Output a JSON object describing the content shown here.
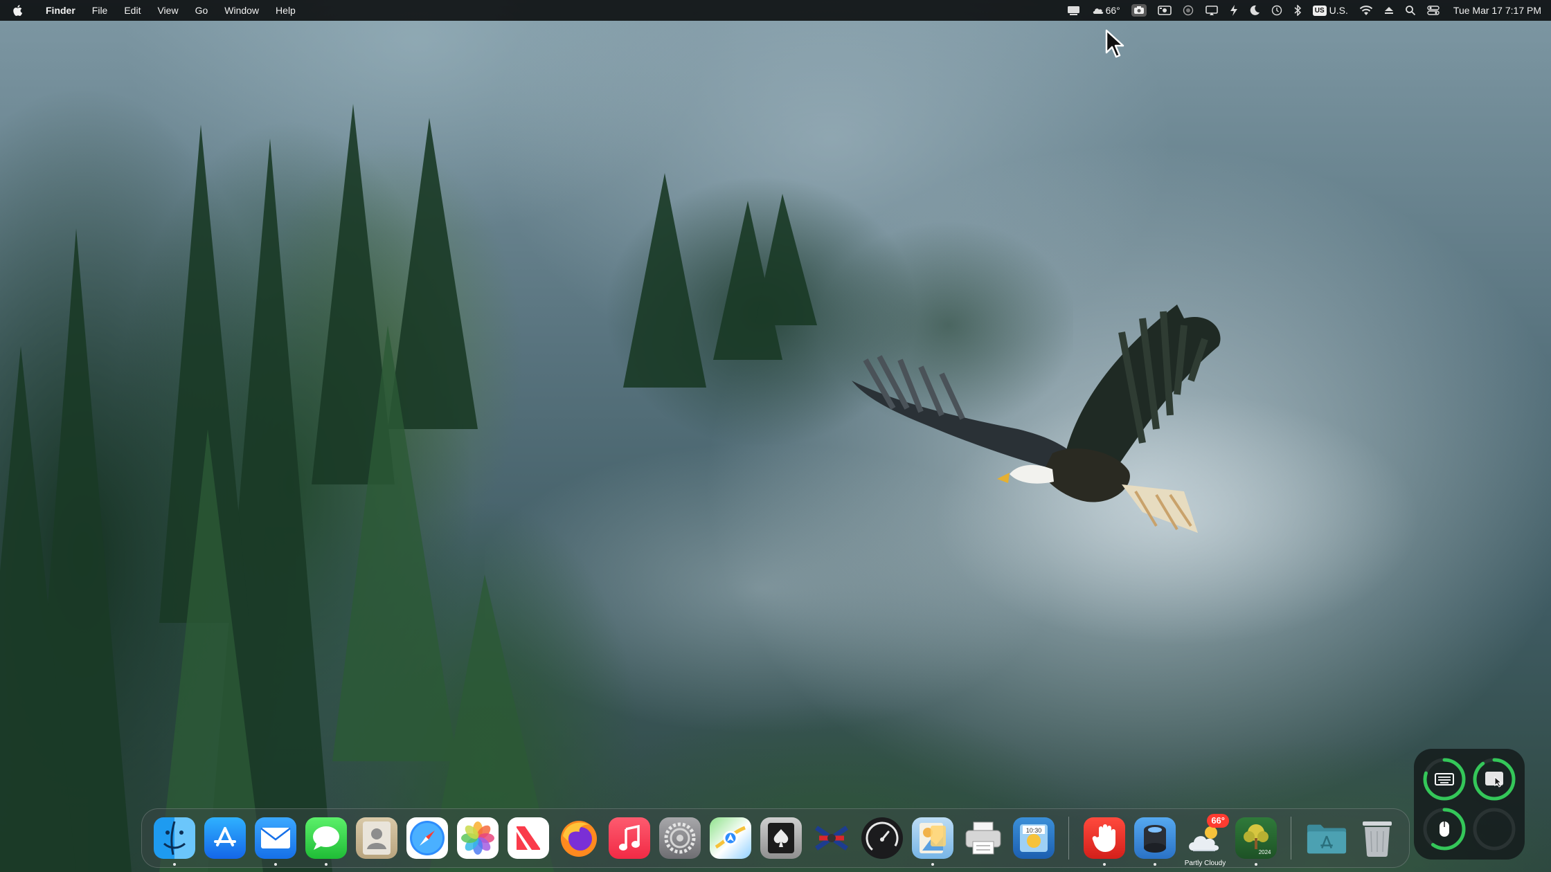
{
  "menubar": {
    "apple_icon": "apple-logo-icon",
    "app_name": "Finder",
    "menus": [
      "File",
      "Edit",
      "View",
      "Go",
      "Window",
      "Help"
    ],
    "status": {
      "weather_temp": "66°",
      "input_source_badge": "US",
      "input_source_label": "U.S.",
      "datetime": "Tue Mar 17  7:17 PM"
    }
  },
  "dock": {
    "apps": [
      {
        "name": "Finder",
        "icon": "finder-icon",
        "running": true
      },
      {
        "name": "App Store",
        "icon": "app-store-icon",
        "running": false
      },
      {
        "name": "Mail",
        "icon": "mail-icon",
        "running": true
      },
      {
        "name": "Messages",
        "icon": "messages-icon",
        "running": true
      },
      {
        "name": "Contacts",
        "icon": "contacts-icon",
        "running": false
      },
      {
        "name": "Safari",
        "icon": "safari-icon",
        "running": false
      },
      {
        "name": "Photos",
        "icon": "photos-icon",
        "running": false
      },
      {
        "name": "News",
        "icon": "news-icon",
        "running": false
      },
      {
        "name": "Firefox",
        "icon": "firefox-icon",
        "running": false
      },
      {
        "name": "Music",
        "icon": "music-icon",
        "running": false
      },
      {
        "name": "System Settings",
        "icon": "system-settings-icon",
        "running": false
      },
      {
        "name": "Maps",
        "icon": "maps-icon",
        "running": false
      },
      {
        "name": "Solitaire",
        "icon": "solitaire-icon",
        "running": false
      },
      {
        "name": "Chess",
        "icon": "chess-icon",
        "running": false
      },
      {
        "name": "Activity Monitor",
        "icon": "speedometer-icon",
        "running": false
      },
      {
        "name": "Preview",
        "icon": "preview-icon",
        "running": true
      },
      {
        "name": "Printer",
        "icon": "printer-icon",
        "running": false
      },
      {
        "name": "Image Capture",
        "icon": "image-capture-icon",
        "running": false
      }
    ],
    "extras": [
      {
        "name": "Stop",
        "icon": "stop-hand-icon",
        "running": true
      },
      {
        "name": "Hard Drive Utility",
        "icon": "drive-icon",
        "running": true
      },
      {
        "name": "Weather",
        "icon": "weather-icon",
        "running": true,
        "badge": "66°",
        "label": "Partly Cloudy"
      },
      {
        "name": "Calendar Tree",
        "icon": "tree-icon",
        "running": true,
        "sub": "2024"
      }
    ],
    "trailing": [
      {
        "name": "Applications",
        "icon": "applications-folder-icon"
      },
      {
        "name": "Trash",
        "icon": "trash-icon"
      }
    ]
  },
  "battery_widget": {
    "accent": "#34c759",
    "devices": [
      {
        "name": "Keyboard",
        "icon": "keyboard-icon",
        "level": 0.8
      },
      {
        "name": "Trackpad",
        "icon": "trackpad-icon",
        "level": 0.9
      },
      {
        "name": "Mouse",
        "icon": "mouse-icon",
        "level": 0.6
      },
      {
        "name": "Empty",
        "icon": "empty-slot-icon",
        "level": 0
      }
    ]
  }
}
